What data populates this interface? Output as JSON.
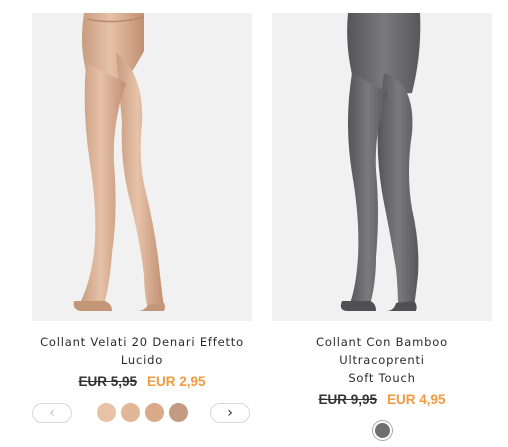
{
  "products": [
    {
      "title_line1": "Collant Velati 20 Denari Effetto",
      "title_line2": "Lucido",
      "old_price": "EUR 5,95",
      "new_price": "EUR 2,95",
      "image_icon": "legs-nude-tights-image",
      "swatch_colors": [
        "#e8c2a6",
        "#e2b798",
        "#d9a98a",
        "#c39a82"
      ],
      "has_carousel": true,
      "prev_icon": "chevron-left-icon",
      "next_icon": "chevron-right-icon"
    },
    {
      "title_line1": "Collant Con Bamboo Ultracoprenti",
      "title_line2": "Soft Touch",
      "old_price": "EUR 9,95",
      "new_price": "EUR 4,95",
      "image_icon": "legs-grey-tights-image",
      "swatch_colors": [
        "#6f6f71"
      ],
      "has_carousel": false
    }
  ],
  "colors": {
    "sale_price": "#f29a3d",
    "old_price": "#333333",
    "image_bg": "#f1f1f1"
  }
}
